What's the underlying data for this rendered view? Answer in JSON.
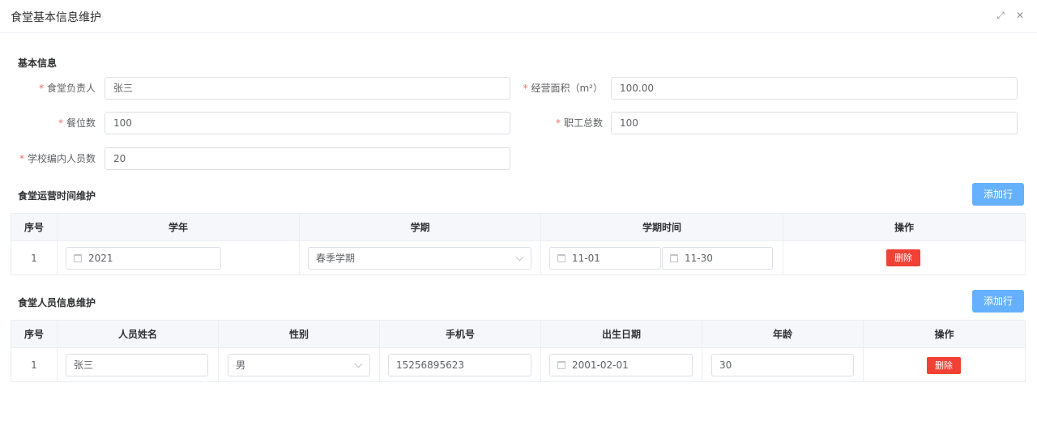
{
  "dialog": {
    "title": "食堂基本信息维护",
    "fullscreen_icon": "⤢",
    "close_icon": "✕"
  },
  "basic": {
    "section_title": "基本信息",
    "required_mark": "*",
    "fields": {
      "manager": {
        "label": "食堂负责人",
        "value": "张三"
      },
      "area": {
        "label": "经营面积（m²）",
        "value": "100.00"
      },
      "seats": {
        "label": "餐位数",
        "value": "100"
      },
      "staff_total": {
        "label": "职工总数",
        "value": "100"
      },
      "school_staff": {
        "label": "学校编内人员数",
        "value": "20"
      }
    }
  },
  "operation": {
    "section_title": "食堂运营时间维护",
    "add_button": "添加行",
    "headers": [
      "序号",
      "学年",
      "学期",
      "学期时间",
      "操作"
    ],
    "rows": [
      {
        "index": "1",
        "year": "2021",
        "term": "春季学期",
        "start": "11-01",
        "end": "11-30",
        "delete": "删除"
      }
    ]
  },
  "staff": {
    "section_title": "食堂人员信息维护",
    "add_button": "添加行",
    "headers": [
      "序号",
      "人员姓名",
      "性别",
      "手机号",
      "出生日期",
      "年龄",
      "操作"
    ],
    "rows": [
      {
        "index": "1",
        "name": "张三",
        "gender": "男",
        "phone": "15256895623",
        "birthday": "2001-02-01",
        "age": "30",
        "delete": "删除"
      }
    ]
  },
  "colors": {
    "primary_light": "#66b1ff",
    "danger": "#f04134",
    "required": "#f56c6c",
    "border": "#dcdfe6"
  }
}
